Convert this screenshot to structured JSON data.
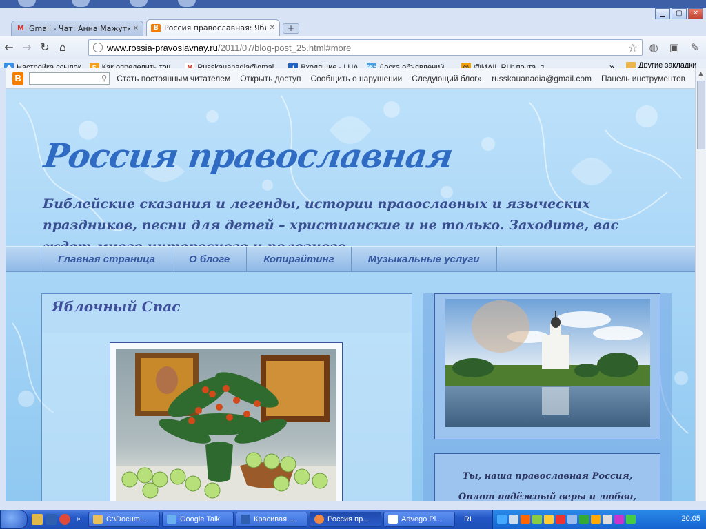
{
  "browser": {
    "tabs": [
      {
        "label": "Gmail - Чат: Анна Мажутко -",
        "favicon": "gmail-icon",
        "active": false
      },
      {
        "label": "Россия православная: Яблоч",
        "favicon": "blogger-icon",
        "active": true
      }
    ],
    "url_host": "www.rossia-pravoslavnay.ru",
    "url_path": "/2011/07/blog-post_25.html#more",
    "bookmarks": [
      {
        "label": "Настройка ссылок",
        "icon": "windows-icon",
        "color": "#3a8ee6"
      },
      {
        "label": "Как определить точ...",
        "icon": "shield-s-icon",
        "color": "#f0a020"
      },
      {
        "label": "Russkauanadia@gmai...",
        "icon": "gmail-icon",
        "color": "#d93025"
      },
      {
        "label": "Входящие - I.UA",
        "icon": "info-icon",
        "color": "#2460c0"
      },
      {
        "label": "Доска объявлений ...",
        "icon": "ads-icon",
        "color": "#4a9fe0"
      },
      {
        "label": "@MAIL.RU: почта, п...",
        "icon": "mailru-icon",
        "color": "#f0a000"
      }
    ],
    "bookmarks_more": "»",
    "other_bookmarks": "Другие закладки"
  },
  "blogger_bar": {
    "links": [
      "Стать постоянным читателем",
      "Открыть доступ",
      "Сообщить о нарушении",
      "Следующий блог»",
      "russkauanadia@gmail.com",
      "Панель инструментов"
    ]
  },
  "blog": {
    "title": "Россия православная",
    "description": "Библейские сказания и легенды, истории православных и языческих праздников, песни для детей – христианские и не только. Заходите, вас ждет много интересного и полезного.",
    "menu": [
      "Главная страница",
      "О блоге",
      "Копирайтинг",
      "Музыкальные услуги"
    ],
    "post_title": "Яблочный Спас",
    "poem_lines": [
      "Ты, наша православная Россия,",
      "Оплот надёжный веры и любви,"
    ]
  },
  "taskbar": {
    "tasks": [
      {
        "label": "C:\\Docum...",
        "color": "#e8c15a"
      },
      {
        "label": "Google Talk",
        "color": "#6ab0f0"
      },
      {
        "label": "Красивая ...",
        "color": "#2f5fb0"
      },
      {
        "label": "Россия пр...",
        "color": "#e84",
        "active": true
      },
      {
        "label": "Advego Pl...",
        "color": "#fff"
      }
    ],
    "lang": "RL",
    "clock": "20:05"
  }
}
